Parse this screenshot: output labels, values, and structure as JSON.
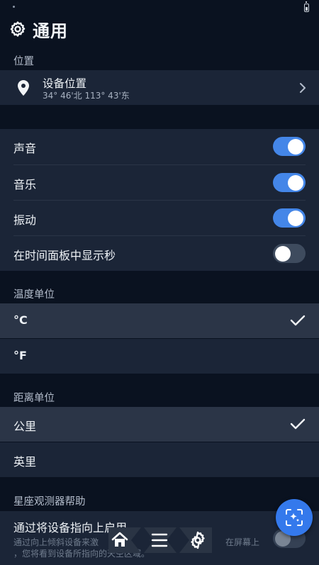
{
  "header": {
    "title": "通用",
    "icon": "gear-icon"
  },
  "location": {
    "section_title": "位置",
    "device_location_label": "设备位置",
    "device_location_value": "34° 46'北 113° 43'东"
  },
  "toggles": [
    {
      "label": "声音",
      "on": true
    },
    {
      "label": "音乐",
      "on": true
    },
    {
      "label": "振动",
      "on": true
    },
    {
      "label": "在时间面板中显示秒",
      "on": false
    }
  ],
  "temperature": {
    "section_title": "温度单位",
    "options": [
      {
        "label": "°C",
        "selected": true
      },
      {
        "label": "°F",
        "selected": false
      }
    ]
  },
  "distance": {
    "section_title": "距离单位",
    "options": [
      {
        "label": "公里",
        "selected": true
      },
      {
        "label": "英里",
        "selected": false
      }
    ]
  },
  "star_help": {
    "section_title": "星座观测器帮助",
    "label": "通过将设备指向上启用",
    "description_line1": "通过向上倾斜设备来激",
    "description_line1_right": "在屏幕上",
    "description_line2": "，您将看到设备所指向的天空区域。",
    "on": false
  },
  "colors": {
    "accent": "#4486e8",
    "background": "#0a1220",
    "card": "#1b2537",
    "selected_row": "#2b3547"
  },
  "bottom_nav": {
    "items": [
      "home-icon",
      "menu-icon",
      "gear-icon"
    ]
  },
  "fab_icon": "sparkle-scan-icon"
}
